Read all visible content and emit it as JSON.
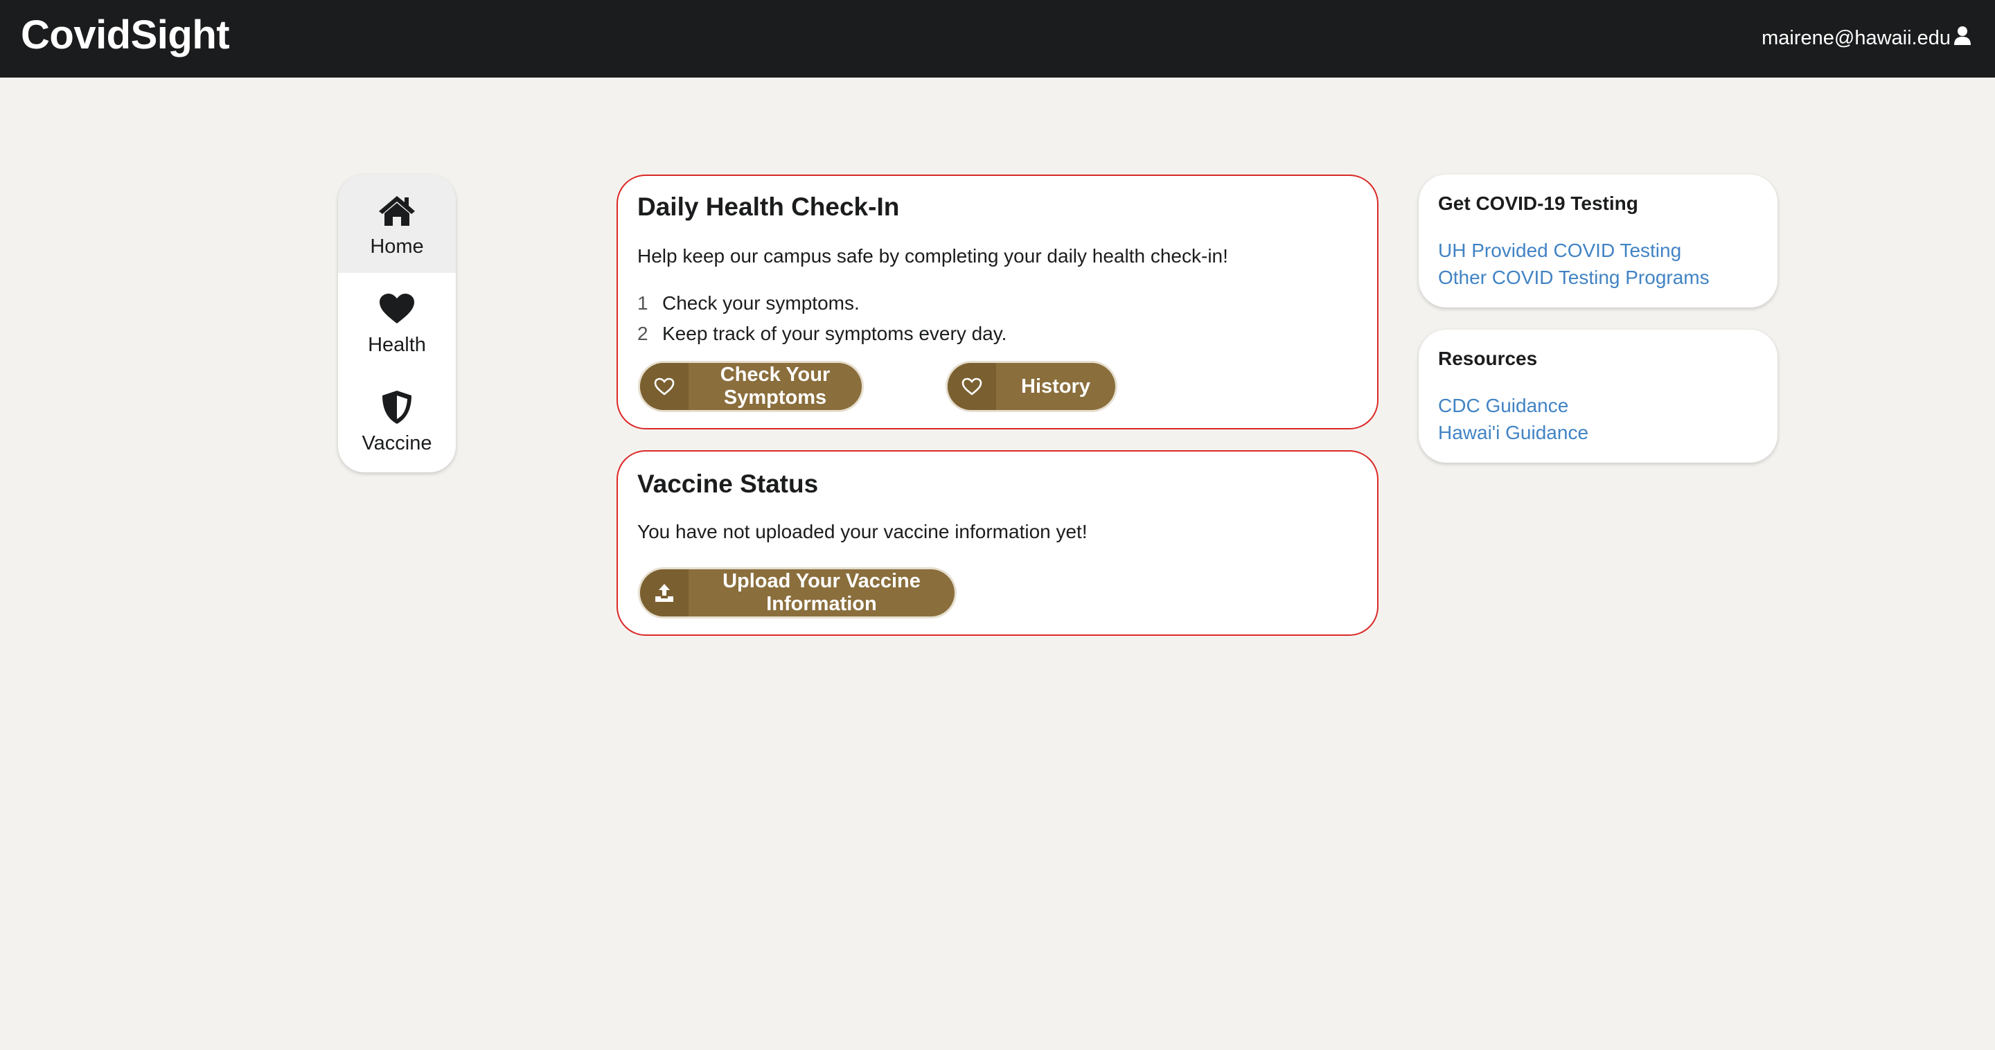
{
  "header": {
    "brand": "CovidSight",
    "user_email": "mairene@hawaii.edu"
  },
  "sidebar": {
    "items": [
      {
        "label": "Home",
        "icon": "home-icon",
        "active": true
      },
      {
        "label": "Health",
        "icon": "heart-icon"
      },
      {
        "label": "Vaccine",
        "icon": "shield-icon"
      }
    ]
  },
  "checkin": {
    "title": "Daily Health Check-In",
    "description": "Help keep our campus safe by completing your daily health check-in!",
    "steps": [
      {
        "num": "1",
        "text": "Check your symptoms."
      },
      {
        "num": "2",
        "text": "Keep track of your symptoms every day."
      }
    ],
    "check_button": "Check Your Symptoms",
    "history_button": "History"
  },
  "vaccine": {
    "title": "Vaccine Status",
    "description": "You have not uploaded your vaccine information yet!",
    "upload_button": "Upload Your Vaccine Information"
  },
  "testing": {
    "title": "Get COVID-19 Testing",
    "links": [
      "UH Provided COVID Testing",
      "Other COVID Testing Programs"
    ]
  },
  "resources": {
    "title": "Resources",
    "links": [
      "CDC Guidance",
      "Hawai'i Guidance"
    ]
  },
  "colors": {
    "header_bg": "#1b1c1d",
    "page_bg": "#f4f2ee",
    "card_border": "#db2828",
    "button_bg": "#8a6e3c",
    "link": "#4183c4"
  }
}
